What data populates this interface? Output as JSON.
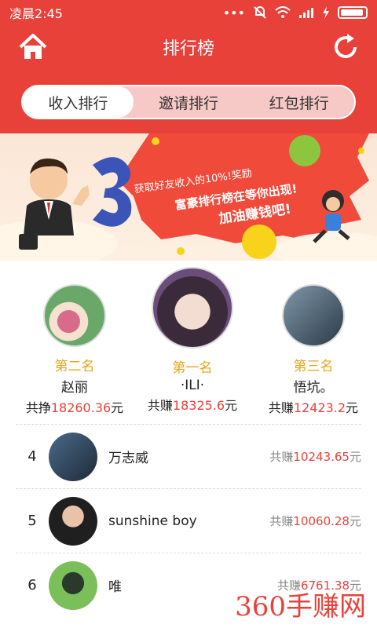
{
  "status": {
    "time": "凌晨2:45"
  },
  "header": {
    "title": "排行榜"
  },
  "tabs": [
    {
      "label": "收入排行",
      "active": true
    },
    {
      "label": "邀请排行",
      "active": false
    },
    {
      "label": "红包排行",
      "active": false
    }
  ],
  "banner": {
    "line1": "获取好友收入的10%!奖励",
    "line2": "富豪排行榜在等你出现!",
    "line3": "加油赚钱吧!"
  },
  "podium": {
    "first": {
      "rank": "第一名",
      "name": "·ILI·",
      "prefix": "共赚",
      "amount": "18325.6",
      "unit": "元"
    },
    "second": {
      "rank": "第二名",
      "name": "赵丽",
      "prefix": "共挣",
      "amount": "18260.36",
      "unit": "元"
    },
    "third": {
      "rank": "第三名",
      "name": "悟坑。",
      "prefix": "共赚",
      "amount": "12423.2",
      "unit": "元"
    }
  },
  "list": [
    {
      "num": "4",
      "name": "万志威",
      "prefix": "共赚",
      "amount": "10243.65",
      "unit": "元"
    },
    {
      "num": "5",
      "name": "sunshine boy",
      "prefix": "共赚",
      "amount": "10060.28",
      "unit": "元"
    },
    {
      "num": "6",
      "name": "唯",
      "prefix": "共赚",
      "amount": "6761.38",
      "unit": "元"
    }
  ],
  "watermark": "360手赚网"
}
